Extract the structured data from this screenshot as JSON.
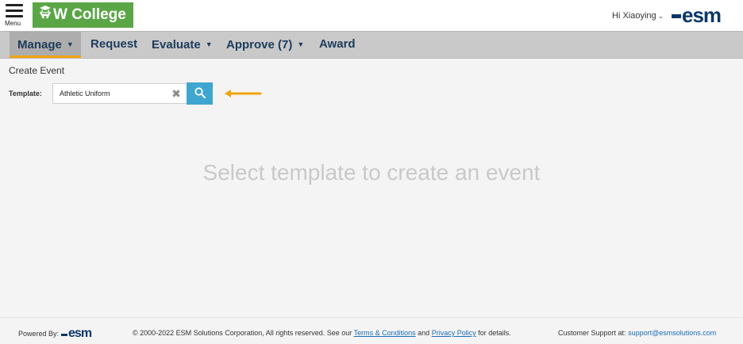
{
  "header": {
    "menu_label": "Menu",
    "logo_text": "W College",
    "greeting": "Hi Xiaoying",
    "brand": "esm",
    "colors": {
      "logo_bg": "#5aa646",
      "brand": "#0b3768"
    }
  },
  "nav": {
    "items": [
      {
        "label": "Manage",
        "has_caret": true,
        "active": true
      },
      {
        "label": "Request",
        "has_caret": false
      },
      {
        "label": "Evaluate",
        "has_caret": true
      },
      {
        "label": "Approve (7)",
        "has_caret": true
      },
      {
        "label": "Award",
        "has_caret": false
      }
    ],
    "colors": {
      "bar": "#c9c9c9",
      "active_underline": "#f0a410",
      "text": "#1d3c5c"
    }
  },
  "main": {
    "title": "Create Event",
    "template_label": "Template:",
    "template_value": "Athletic Uniform",
    "clear_icon": "close-icon",
    "search_icon": "search-icon",
    "empty_message": "Select template to create an event",
    "colors": {
      "search_button": "#3fa6cf",
      "annotation_arrow": "#f0a410"
    }
  },
  "footer": {
    "powered_by": "Powered By:",
    "brand": "esm",
    "copyright_prefix": "© 2000-2022 ESM Solutions Corporation, All rights reserved. See our",
    "terms_link": "Terms & Conditions",
    "and_text": "and",
    "privacy_link": "Privacy Policy",
    "copyright_suffix": "for details.",
    "support_label": "Customer Support at:",
    "support_email": "support@esmsolutions.com"
  }
}
